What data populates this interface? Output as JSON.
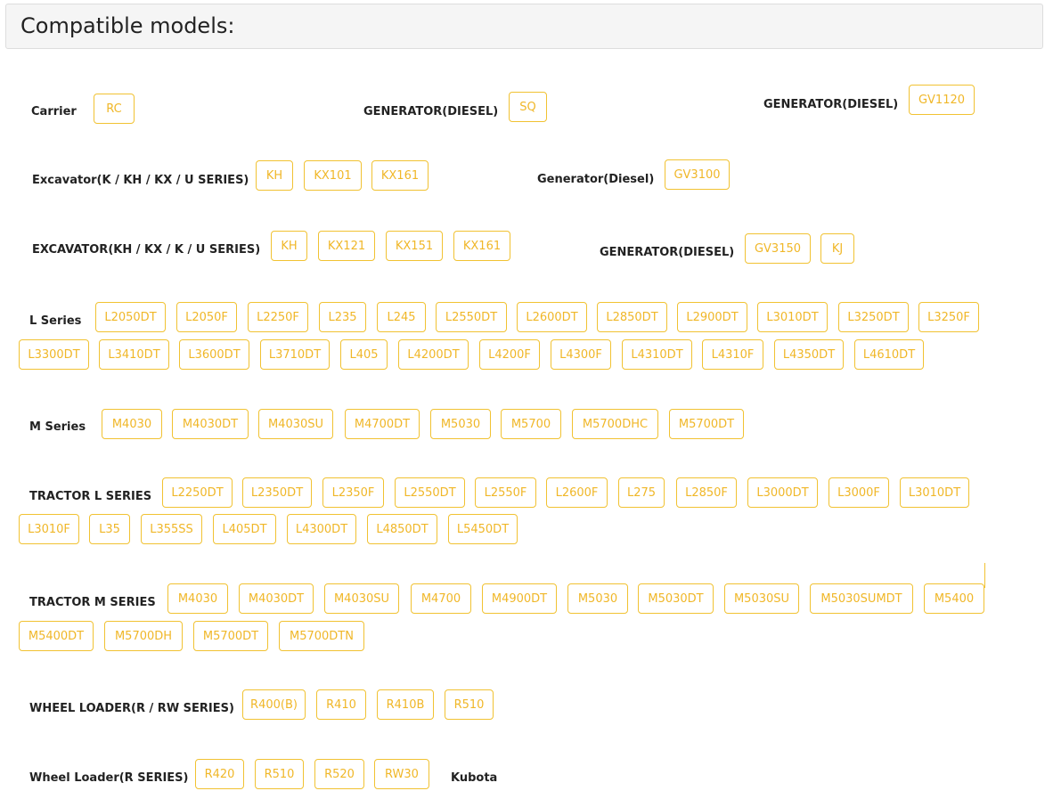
{
  "page": {
    "title": "Compatible models:"
  },
  "colors": {
    "chip_border": "#f1c232",
    "chip_text": "#f0b728",
    "label": "#222222"
  },
  "groups": [
    {
      "label": "Carrier",
      "models": [
        "RC"
      ]
    },
    {
      "label": "GENERATOR(DIESEL)",
      "models": [
        "SQ"
      ]
    },
    {
      "label": "GENERATOR(DIESEL)",
      "models": [
        "GV1120"
      ]
    },
    {
      "label": "Excavator(K / KH / KX / U SERIES)",
      "models": [
        "KH",
        "KX101",
        "KX161"
      ]
    },
    {
      "label": "Generator(Diesel)",
      "models": [
        "GV3100"
      ]
    },
    {
      "label": "EXCAVATOR(KH / KX / K / U SERIES)",
      "models": [
        "KH",
        "KX121",
        "KX151",
        "KX161"
      ]
    },
    {
      "label": "GENERATOR(DIESEL)",
      "models": [
        "GV3150",
        "KJ"
      ]
    },
    {
      "label": "L Series",
      "models": [
        "L2050DT",
        "L2050F",
        "L2250F",
        "L235",
        "L245",
        "L2550DT",
        "L2600DT",
        "L2850DT",
        "L2900DT",
        "L3010DT",
        "L3250DT",
        "L3250F",
        "L3300DT",
        "L3410DT",
        "L3600DT",
        "L3710DT",
        "L405",
        "L4200DT",
        "L4200F",
        "L4300F",
        "L4310DT",
        "L4310F",
        "L4350DT",
        "L4610DT"
      ]
    },
    {
      "label": "M Series",
      "models": [
        "M4030",
        "M4030DT",
        "M4030SU",
        "M4700DT",
        "M5030",
        "M5700",
        "M5700DHC",
        "M5700DT"
      ]
    },
    {
      "label": "TRACTOR L SERIES",
      "models": [
        "L2250DT",
        "L2350DT",
        "L2350F",
        "L2550DT",
        "L2550F",
        "L2600F",
        "L275",
        "L2850F",
        "L3000DT",
        "L3000F",
        "L3010DT",
        "L3010F",
        "L35",
        "L355SS",
        "L405DT",
        "L4300DT",
        "L4850DT",
        "L5450DT"
      ]
    },
    {
      "label": "TRACTOR M SERIES",
      "models": [
        "M4030",
        "M4030DT",
        "M4030SU",
        "M4700",
        "M4900DT",
        "M5030",
        "M5030DT",
        "M5030SU",
        "M5030SUMDT",
        "M5400",
        "M5400DT",
        "M5700DH",
        "M5700DT",
        "M5700DTN"
      ]
    },
    {
      "label": "WHEEL LOADER(R / RW SERIES)",
      "models": [
        "R400(B)",
        "R410",
        "R410B",
        "R510"
      ]
    },
    {
      "label": "Wheel Loader(R SERIES)",
      "models": [
        "R420",
        "R510",
        "R520",
        "RW30"
      ]
    },
    {
      "label": "Kubota",
      "models": []
    }
  ]
}
